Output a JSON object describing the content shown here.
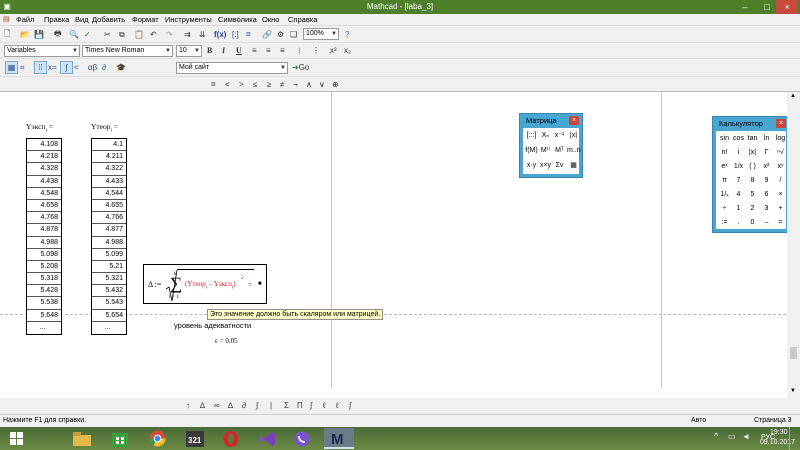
{
  "window": {
    "title": "Mathcad - [laba_3]",
    "controls": [
      "–",
      "□",
      "×"
    ]
  },
  "menu": [
    "Файл",
    "Правка",
    "Вид",
    "Добавить",
    "Формат",
    "Инструменты",
    "Символика",
    "Окно",
    "Справка"
  ],
  "toolbar": {
    "style_select": "Variables",
    "font_select": "Times New Roman",
    "size_select": "10",
    "zoom_select": "100%",
    "bold": "B",
    "italic": "I",
    "underline": "U",
    "site_select": "Мой сайт",
    "go_label": "Go",
    "operators": [
      "=",
      "<",
      ">",
      "≤",
      "≥",
      "≠",
      "¬",
      "∧",
      "∨",
      "⊕"
    ]
  },
  "worksheet": {
    "col1_header": "Yэксп",
    "col1_sub": "i",
    "col2_header": "Yтеор",
    "col2_sub": "i",
    "header_eq": "=",
    "yexp": [
      "4.108",
      "4.218",
      "4.328",
      "4.438",
      "4.548",
      "4.658",
      "4.768",
      "4.878",
      "4.988",
      "5.098",
      "5.208",
      "5.318",
      "5.428",
      "5.538",
      "5.648",
      "..."
    ],
    "yteor": [
      "4.1",
      "4.211",
      "4.322",
      "4.433",
      "4.544",
      "4.655",
      "4.766",
      "4.877",
      "4.988",
      "5.099",
      "5.21",
      "5.321",
      "5.432",
      "5.543",
      "5.654",
      "..."
    ],
    "formula": {
      "lhs": "Δ :=",
      "sum_top": "k",
      "sum_bottom": "i = 1",
      "term_a": "Yтеор",
      "term_a_sub": "i",
      "minus": "–",
      "term_b": "Yэксп",
      "term_b_sub": "i",
      "power": "2",
      "rhs": "=",
      "placeholder": "■"
    },
    "tooltip": "Это значение должно быть скаляром или матрицей.",
    "adequacy_label": "уровень адекватности",
    "epsilon": "ε = 0.05"
  },
  "matrix_panel": {
    "title": "Матрица",
    "close": "×",
    "buttons": [
      "[:::]",
      "Xₙ",
      "x⁻¹",
      "|x|",
      "f(M)",
      "M⁽⁾",
      "Mᵀ",
      "m..n",
      "x·y",
      "x×y",
      "Σv",
      "▦"
    ]
  },
  "calculator_panel": {
    "title": "Калькулятор",
    "close": "×",
    "buttons": [
      "sin",
      "cos",
      "tan",
      "ln",
      "log",
      "n!",
      "i",
      "|x|",
      "Γ",
      "ⁿ√",
      "eˣ",
      "1/x",
      "( )",
      "x²",
      "xʸ",
      "π",
      "7",
      "8",
      "9",
      "/",
      "1/ₓ",
      "4",
      "5",
      "6",
      "×",
      "÷",
      "1",
      "2",
      "3",
      "+",
      ":=",
      ".",
      "0",
      "–",
      "="
    ]
  },
  "status": {
    "help": "Нажмите F1 для справки.",
    "mode": "Авто",
    "page": "Страница 3"
  },
  "taskbar": {
    "lang": "РУС",
    "time": "19:30",
    "date": "09.10.2017"
  }
}
